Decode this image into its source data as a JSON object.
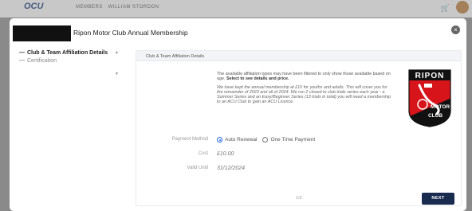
{
  "background": {
    "logo": "OCU",
    "members_label": "MEMBERS · WILLIAM STORDON"
  },
  "dialog": {
    "title": "Ripon Motor Club Annual Membership",
    "close_label": "×"
  },
  "sidebar": {
    "items": [
      {
        "label": "Club & Team Affiliation Details",
        "active": true
      },
      {
        "label": "Certification",
        "active": false
      }
    ],
    "scroll_up": "▲",
    "scroll_down": "▼"
  },
  "panel": {
    "header": "Club & Team Affiliation Details",
    "info_intro": "The available affiliation types may have been filtered to only show those available based on age. ",
    "info_intro_bold": "Select to see details and price.",
    "info_detail": "We have kept the annual membership at £10 for youths and adults. This will cover you for the remainder of 2023 and all of 2024. We run 2 closed to club trials series each year - a Summer Series and an Easy/Beginner Series (13 trials in total) you will need a membership to an ACU Club to gain an ACU Licence.",
    "club_logo": {
      "top_text": "RIPON",
      "mid_text": "MOTOR",
      "bottom_text": "CLUB"
    },
    "payment": {
      "label": "Payment Method",
      "options": [
        "Auto Renewal",
        "One Time Payment"
      ],
      "selected": "Auto Renewal"
    },
    "cost": {
      "label": "Cost",
      "value": "£10.00"
    },
    "valid": {
      "label": "Valid Until",
      "value": "31/12/2024"
    },
    "pager": "1/2",
    "next_label": "NEXT"
  },
  "colors": {
    "accent": "#1a2b50",
    "radio": "#2563eb",
    "logo_red": "#d6141a"
  }
}
